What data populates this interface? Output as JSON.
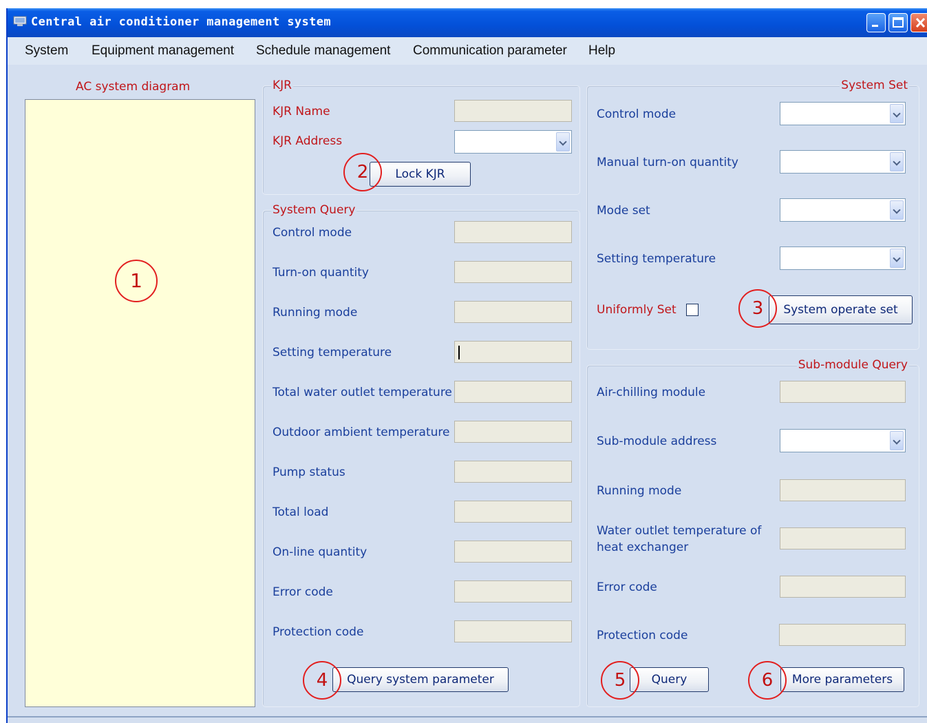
{
  "window": {
    "title": "Central air conditioner management system"
  },
  "menu": [
    "System",
    "Equipment management",
    "Schedule management",
    "Communication parameter",
    "Help"
  ],
  "diagram_panel": {
    "title": "AC system diagram"
  },
  "kjr": {
    "legend": "KJR",
    "name_label": "KJR Name",
    "address_label": "KJR Address",
    "lock_button": "Lock KJR"
  },
  "system_query": {
    "legend": "System Query",
    "fields": [
      "Control mode",
      "Turn-on quantity",
      "Running mode",
      "Setting temperature",
      "Total water outlet temperature",
      "Outdoor ambient temperature",
      "Pump status",
      "Total load",
      "On-line quantity",
      "Error code",
      "Protection code"
    ],
    "query_button": "Query system parameter"
  },
  "system_set": {
    "legend": "System Set",
    "fields": [
      "Control mode",
      "Manual turn-on quantity",
      "Mode set",
      "Setting temperature"
    ],
    "uniform_label": "Uniformly Set",
    "operate_button": "System operate set"
  },
  "submodule_query": {
    "legend": "Sub-module Query",
    "air_chilling_label": "Air-chilling module",
    "address_label": "Sub-module address",
    "running_mode_label": "Running mode",
    "water_outlet_label_1": "Water outlet temperature of",
    "water_outlet_label_2": "heat exchanger",
    "error_label": "Error code",
    "protection_label": "Protection code",
    "query_button": "Query",
    "more_button": "More parameters"
  },
  "markers": [
    "1",
    "2",
    "3",
    "4",
    "5",
    "6"
  ],
  "colors": {
    "label_red": "#c0161a",
    "label_blue": "#1a3f9c",
    "marker_red": "#e21f1f",
    "diagram_bg": "#ffffd9",
    "window_bg": "#d4dff0"
  },
  "icons": {
    "app": "monitor-icon",
    "minimize": "minimize-icon",
    "maximize": "maximize-icon",
    "close": "close-icon",
    "dropdown": "chevron-down-icon"
  }
}
